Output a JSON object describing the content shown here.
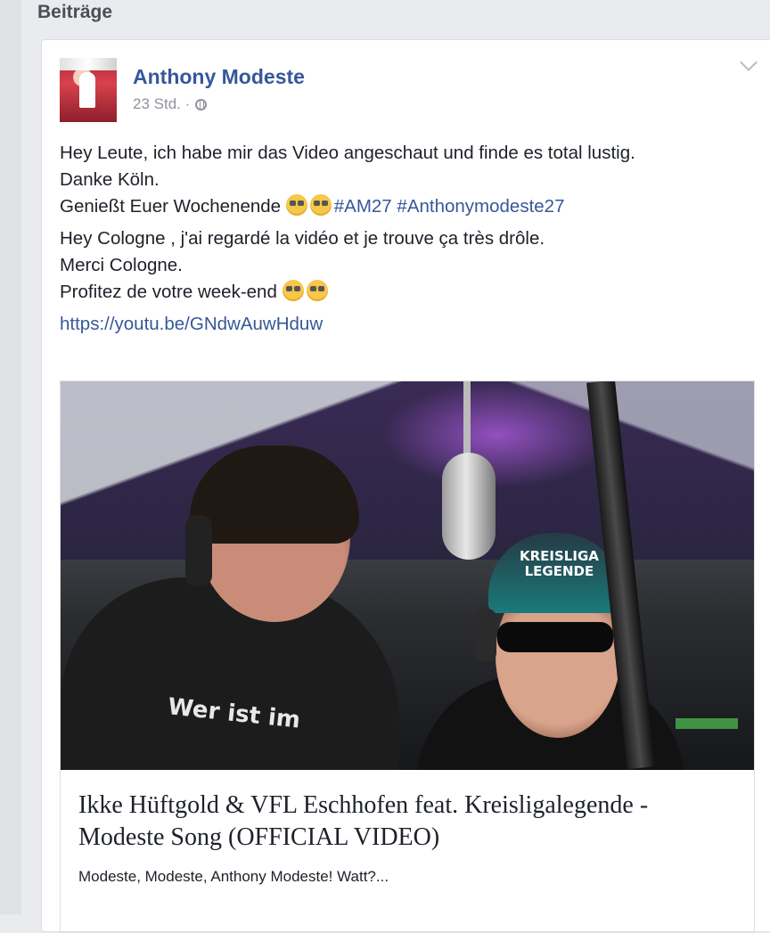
{
  "section": {
    "title": "Beiträge"
  },
  "post": {
    "author": "Anthony Modeste",
    "time": "23 Std. ·",
    "privacy_icon": "globe-icon",
    "menu_icon": "chevron-down-icon",
    "lines": {
      "l1": "Hey Leute, ich habe mir das Video angeschaut und finde es total lustig.",
      "l2": "Danke Köln.",
      "l3_text": "Genießt Euer Wochenende ",
      "hashtag1": "#AM27",
      "hashtag2": "#Anthonymodeste27",
      "l4": "Hey Cologne , j'ai regardé la vidéo et je trouve ça très drôle.",
      "l5": "Merci Cologne.",
      "l6_text": "Profitez de votre week-end ",
      "link": "https://youtu.be/GNdwAuwHduw"
    },
    "preview": {
      "title": "Ikke Hüftgold & VFL Eschhofen feat. Kreisligalegende - Modeste Song (OFFICIAL VIDEO)",
      "description": "Modeste, Modeste, Anthony Modeste! Watt?...",
      "shirt_text": "Wer ist im",
      "cap_text": "KREISLIGA\nLEGENDE"
    }
  },
  "colors": {
    "link": "#365899",
    "text": "#1d2129",
    "muted": "#90949c",
    "background": "#e9ebee"
  }
}
